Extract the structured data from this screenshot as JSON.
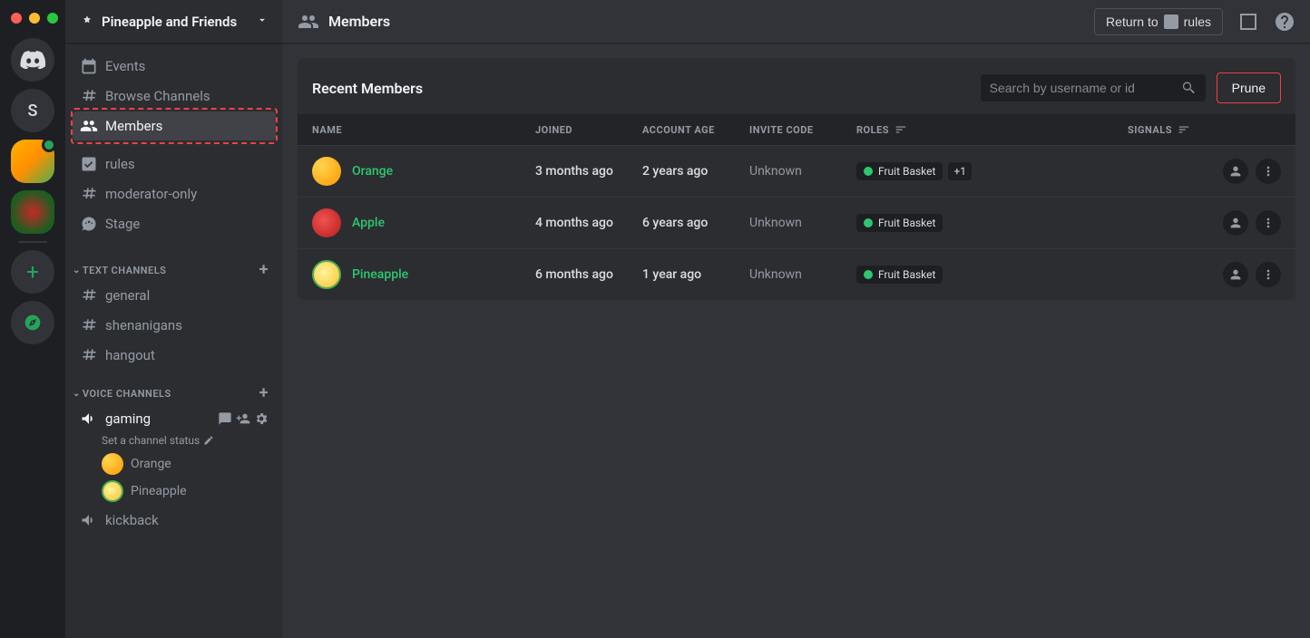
{
  "server": {
    "name": "Pineapple and Friends"
  },
  "server_rail": {
    "letter": "S"
  },
  "sidebar_nav": {
    "events": "Events",
    "browse": "Browse Channels",
    "members": "Members"
  },
  "channels": {
    "rules": "rules",
    "moderator": "moderator-only",
    "stage": "Stage"
  },
  "categories": {
    "text_label": "TEXT CHANNELS",
    "voice_label": "VOICE CHANNELS"
  },
  "text_channels": {
    "general": "general",
    "shenanigans": "shenanigans",
    "hangout": "hangout"
  },
  "voice_channels": {
    "gaming": "gaming",
    "gaming_status": "Set a channel status",
    "kickback": "kickback",
    "users": {
      "orange": "Orange",
      "pineapple": "Pineapple"
    }
  },
  "topbar": {
    "title": "Members",
    "return_prefix": "Return to",
    "return_target": "rules"
  },
  "panel": {
    "title": "Recent Members",
    "search_placeholder": "Search by username or id",
    "prune": "Prune"
  },
  "table": {
    "headers": {
      "name": "NAME",
      "joined": "JOINED",
      "age": "ACCOUNT AGE",
      "invite": "INVITE CODE",
      "roles": "ROLES",
      "signals": "SIGNALS"
    },
    "rows": [
      {
        "name": "Orange",
        "joined": "3 months ago",
        "age": "2 years ago",
        "invite": "Unknown",
        "role": "Fruit Basket",
        "extra": "+1",
        "avatar": "orange"
      },
      {
        "name": "Apple",
        "joined": "4 months ago",
        "age": "6 years ago",
        "invite": "Unknown",
        "role": "Fruit Basket",
        "extra": "",
        "avatar": "apple"
      },
      {
        "name": "Pineapple",
        "joined": "6 months ago",
        "age": "1 year ago",
        "invite": "Unknown",
        "role": "Fruit Basket",
        "extra": "",
        "avatar": "pineapple"
      }
    ]
  }
}
